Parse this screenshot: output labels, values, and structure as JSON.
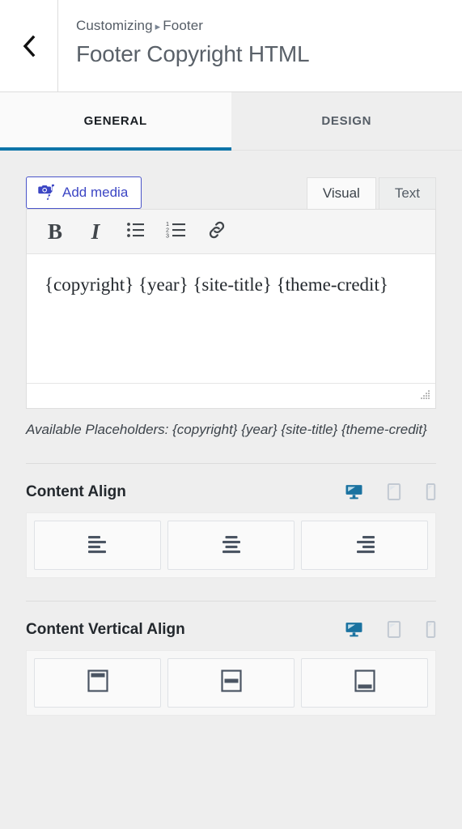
{
  "header": {
    "back_icon": "chevron-left-icon",
    "breadcrumb_root": "Customizing",
    "breadcrumb_separator": "▸",
    "breadcrumb_current": "Footer",
    "panel_title": "Footer Copyright HTML"
  },
  "tabs": [
    {
      "label": "GENERAL",
      "active": true
    },
    {
      "label": "DESIGN",
      "active": false
    }
  ],
  "editor": {
    "add_media_label": "Add media",
    "add_media_icon": "media-camera-music-icon",
    "mode_tabs": [
      {
        "label": "Visual",
        "active": true
      },
      {
        "label": "Text",
        "active": false
      }
    ],
    "toolbar": [
      {
        "icon": "bold-icon",
        "glyph": "B"
      },
      {
        "icon": "italic-icon",
        "glyph": "I"
      },
      {
        "icon": "unordered-list-icon",
        "glyph": ""
      },
      {
        "icon": "ordered-list-icon",
        "glyph": ""
      },
      {
        "icon": "link-icon",
        "glyph": ""
      }
    ],
    "content": "{copyright} {year} {site-title} {theme-credit}",
    "resize_handle_icon": "resize-grip-icon",
    "help_text": "Available Placeholders: {copyright} {year} {site-title} {theme-credit}"
  },
  "controls": [
    {
      "label": "Content Align",
      "devices": [
        {
          "icon": "desktop-icon",
          "active": true
        },
        {
          "icon": "tablet-icon",
          "active": false
        },
        {
          "icon": "mobile-icon",
          "active": false
        }
      ],
      "options": [
        {
          "icon": "align-left-icon",
          "selected": false
        },
        {
          "icon": "align-center-icon",
          "selected": false
        },
        {
          "icon": "align-right-icon",
          "selected": false
        }
      ]
    },
    {
      "label": "Content Vertical Align",
      "devices": [
        {
          "icon": "desktop-icon",
          "active": true
        },
        {
          "icon": "tablet-icon",
          "active": false
        },
        {
          "icon": "mobile-icon",
          "active": false
        }
      ],
      "options": [
        {
          "icon": "valign-top-icon",
          "selected": false
        },
        {
          "icon": "valign-middle-icon",
          "selected": false
        },
        {
          "icon": "valign-bottom-icon",
          "selected": false
        }
      ]
    }
  ],
  "colors": {
    "accent_blue": "#0d74a8",
    "media_button_blue": "#3c46c4",
    "device_active": "#1a72a0",
    "device_inactive": "#c2c9d2",
    "icon_dark": "#4b5563",
    "page_background": "#eeeeee"
  }
}
